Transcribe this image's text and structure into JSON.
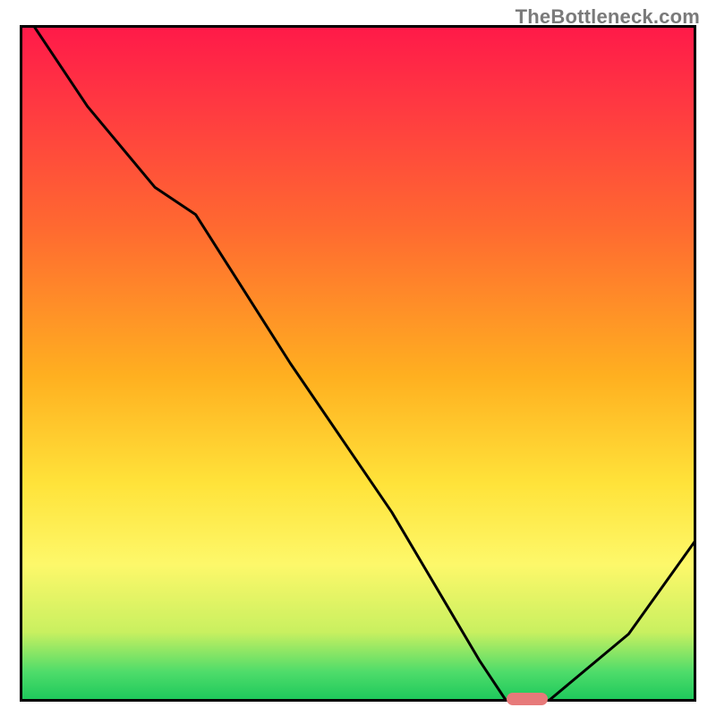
{
  "watermark": "TheBottleneck.com",
  "chart_data": {
    "type": "line",
    "title": "",
    "xlabel": "",
    "ylabel": "",
    "xlim": [
      0,
      100
    ],
    "ylim": [
      0,
      100
    ],
    "x": [
      2,
      10,
      20,
      26,
      40,
      55,
      68,
      72,
      78,
      90,
      100
    ],
    "values": [
      100,
      88,
      76,
      72,
      50,
      28,
      6,
      0,
      0,
      10,
      24
    ],
    "marker": {
      "x_start": 72,
      "x_end": 78,
      "y": 0
    },
    "gradient_stops": [
      {
        "pos": 0,
        "color": "#ff1a49"
      },
      {
        "pos": 12,
        "color": "#ff3a41"
      },
      {
        "pos": 30,
        "color": "#ff6a30"
      },
      {
        "pos": 52,
        "color": "#ffb020"
      },
      {
        "pos": 68,
        "color": "#ffe33a"
      },
      {
        "pos": 80,
        "color": "#fdf86a"
      },
      {
        "pos": 90,
        "color": "#c9f060"
      },
      {
        "pos": 96,
        "color": "#4edc6a"
      },
      {
        "pos": 100,
        "color": "#1fc95c"
      }
    ]
  }
}
